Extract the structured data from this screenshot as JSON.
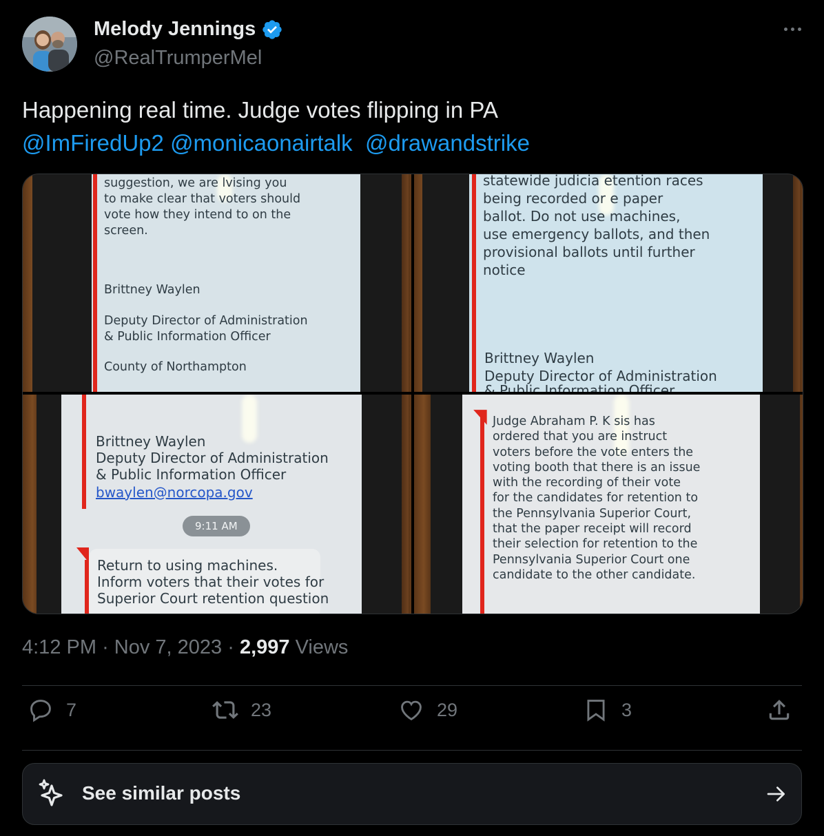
{
  "author": {
    "name": "Melody Jennings",
    "handle": "@RealTrumperMel",
    "verified_color": "#1d9bf0"
  },
  "tweet": {
    "text": "Happening real time. Judge votes flipping in PA",
    "mentions": [
      "@ImFiredUp2",
      "@monicaonairtalk",
      "@drawandstrike"
    ]
  },
  "media": {
    "photo1": {
      "text": "suggestion, we are  lvising you\nto make clear that voters should\nvote how they intend to on the\nscreen.",
      "name": "Brittney Waylen",
      "title": "Deputy Director of Administration\n& Public Information Officer",
      "county": "County of Northampton"
    },
    "photo2": {
      "text": "statewide judicia  etention races\nbeing recorded or  e paper\nballot.  Do not use machines,\nuse emergency ballots, and then\nprovisional ballots until further\nnotice",
      "signature": "Brittney Waylen\nDeputy Director of Administration",
      "cut_line": "& Public Information Officer"
    },
    "photo3": {
      "signature": "Brittney Waylen\nDeputy Director of Administration\n& Public Information Officer",
      "email": "bwaylen@norcopa.gov",
      "time": "9:11 AM",
      "text": "Return to using machines.\nInform voters that their votes for\nSuperior Court retention question"
    },
    "photo4": {
      "text": "Judge Abraham P. K  sis has\nordered that you are   instruct\nvoters before the vote  enters the\nvoting booth that there is an issue\nwith the recording of their vote\nfor the candidates for retention to\nthe Pennsylvania Superior Court,\nthat the paper receipt will record\ntheir selection for retention to the\nPennsylvania Superior Court one\ncandidate to the other candidate."
    }
  },
  "meta": {
    "time": "4:12 PM",
    "date": "Nov 7, 2023",
    "views_count": "2,997",
    "views_label": "Views"
  },
  "actions": {
    "replies": "7",
    "reposts": "23",
    "likes": "29",
    "bookmarks": "3"
  },
  "similar": {
    "label": "See similar posts"
  }
}
